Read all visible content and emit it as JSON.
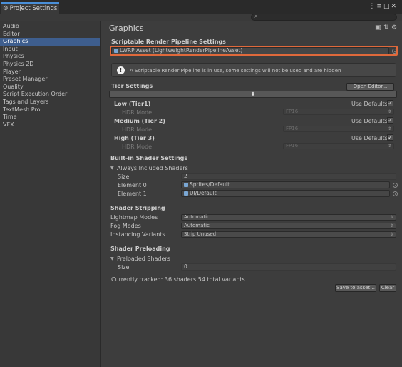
{
  "window": {
    "tab_title": "Project Settings",
    "controls": "⋮≡□✕"
  },
  "search": {
    "placeholder": ""
  },
  "sidebar": {
    "items": [
      {
        "label": "Audio"
      },
      {
        "label": "Editor"
      },
      {
        "label": "Graphics",
        "selected": true
      },
      {
        "label": "Input"
      },
      {
        "label": "Physics"
      },
      {
        "label": "Physics 2D"
      },
      {
        "label": "Player"
      },
      {
        "label": "Preset Manager"
      },
      {
        "label": "Quality"
      },
      {
        "label": "Script Execution Order"
      },
      {
        "label": "Tags and Layers"
      },
      {
        "label": "TextMesh Pro"
      },
      {
        "label": "Time"
      },
      {
        "label": "VFX"
      }
    ]
  },
  "main": {
    "title": "Graphics",
    "srp": {
      "heading": "Scriptable Render Pipeline Settings",
      "value": "LWRP Asset (LightweightRenderPipelineAsset)",
      "help": "A Scriptable Render Pipeline is in use, some settings will not be used and are hidden"
    },
    "tiers": {
      "heading": "Tier Settings",
      "open_editor": "Open Editor...",
      "download_arrow": "⬇",
      "use_defaults_label": "Use Defaults",
      "hdr_label": "HDR Mode",
      "items": [
        {
          "name": "Low (Tier1)",
          "hdr": "FP16",
          "use_defaults": true
        },
        {
          "name": "Medium (Tier 2)",
          "hdr": "FP16",
          "use_defaults": true
        },
        {
          "name": "High (Tier 3)",
          "hdr": "FP16",
          "use_defaults": true
        }
      ]
    },
    "builtin": {
      "heading": "Built-in Shader Settings",
      "always_included": "Always Included Shaders",
      "size_label": "Size",
      "size": "2",
      "elements": [
        {
          "label": "Element 0",
          "value": "Sprites/Default"
        },
        {
          "label": "Element 1",
          "value": "UI/Default"
        }
      ]
    },
    "stripping": {
      "heading": "Shader Stripping",
      "rows": [
        {
          "label": "Lightmap Modes",
          "value": "Automatic"
        },
        {
          "label": "Fog Modes",
          "value": "Automatic"
        },
        {
          "label": "Instancing Variants",
          "value": "Strip Unused"
        }
      ]
    },
    "preloading": {
      "heading": "Shader Preloading",
      "preloaded": "Preloaded Shaders",
      "size_label": "Size",
      "size": "0",
      "tracked": "Currently tracked: 36 shaders 54 total variants",
      "save_button": "Save to asset...",
      "clear_button": "Clear"
    }
  },
  "colors": {
    "accent_selection": "#3e5e8e",
    "highlight_box": "#e0693b",
    "tab_accent": "#4a8fd8"
  }
}
